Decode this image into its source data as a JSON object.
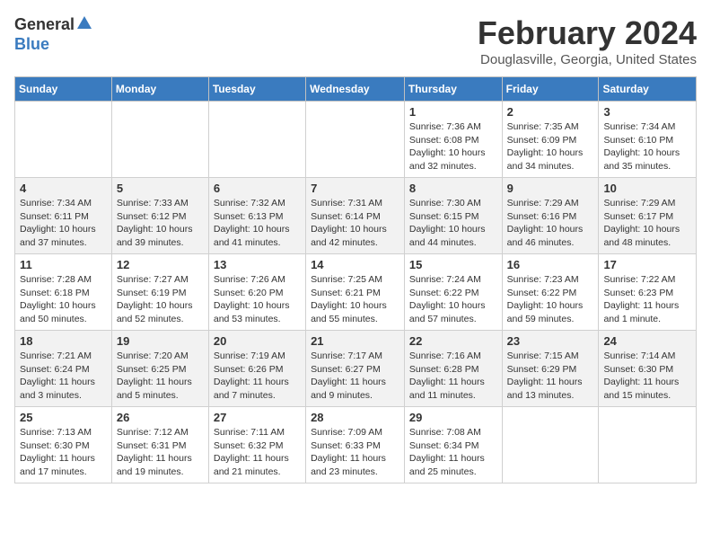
{
  "header": {
    "logo_general": "General",
    "logo_blue": "Blue",
    "month_title": "February 2024",
    "location": "Douglasville, Georgia, United States"
  },
  "days_of_week": [
    "Sunday",
    "Monday",
    "Tuesday",
    "Wednesday",
    "Thursday",
    "Friday",
    "Saturday"
  ],
  "weeks": [
    [
      {
        "day": "",
        "detail": ""
      },
      {
        "day": "",
        "detail": ""
      },
      {
        "day": "",
        "detail": ""
      },
      {
        "day": "",
        "detail": ""
      },
      {
        "day": "1",
        "detail": "Sunrise: 7:36 AM\nSunset: 6:08 PM\nDaylight: 10 hours\nand 32 minutes."
      },
      {
        "day": "2",
        "detail": "Sunrise: 7:35 AM\nSunset: 6:09 PM\nDaylight: 10 hours\nand 34 minutes."
      },
      {
        "day": "3",
        "detail": "Sunrise: 7:34 AM\nSunset: 6:10 PM\nDaylight: 10 hours\nand 35 minutes."
      }
    ],
    [
      {
        "day": "4",
        "detail": "Sunrise: 7:34 AM\nSunset: 6:11 PM\nDaylight: 10 hours\nand 37 minutes."
      },
      {
        "day": "5",
        "detail": "Sunrise: 7:33 AM\nSunset: 6:12 PM\nDaylight: 10 hours\nand 39 minutes."
      },
      {
        "day": "6",
        "detail": "Sunrise: 7:32 AM\nSunset: 6:13 PM\nDaylight: 10 hours\nand 41 minutes."
      },
      {
        "day": "7",
        "detail": "Sunrise: 7:31 AM\nSunset: 6:14 PM\nDaylight: 10 hours\nand 42 minutes."
      },
      {
        "day": "8",
        "detail": "Sunrise: 7:30 AM\nSunset: 6:15 PM\nDaylight: 10 hours\nand 44 minutes."
      },
      {
        "day": "9",
        "detail": "Sunrise: 7:29 AM\nSunset: 6:16 PM\nDaylight: 10 hours\nand 46 minutes."
      },
      {
        "day": "10",
        "detail": "Sunrise: 7:29 AM\nSunset: 6:17 PM\nDaylight: 10 hours\nand 48 minutes."
      }
    ],
    [
      {
        "day": "11",
        "detail": "Sunrise: 7:28 AM\nSunset: 6:18 PM\nDaylight: 10 hours\nand 50 minutes."
      },
      {
        "day": "12",
        "detail": "Sunrise: 7:27 AM\nSunset: 6:19 PM\nDaylight: 10 hours\nand 52 minutes."
      },
      {
        "day": "13",
        "detail": "Sunrise: 7:26 AM\nSunset: 6:20 PM\nDaylight: 10 hours\nand 53 minutes."
      },
      {
        "day": "14",
        "detail": "Sunrise: 7:25 AM\nSunset: 6:21 PM\nDaylight: 10 hours\nand 55 minutes."
      },
      {
        "day": "15",
        "detail": "Sunrise: 7:24 AM\nSunset: 6:22 PM\nDaylight: 10 hours\nand 57 minutes."
      },
      {
        "day": "16",
        "detail": "Sunrise: 7:23 AM\nSunset: 6:22 PM\nDaylight: 10 hours\nand 59 minutes."
      },
      {
        "day": "17",
        "detail": "Sunrise: 7:22 AM\nSunset: 6:23 PM\nDaylight: 11 hours\nand 1 minute."
      }
    ],
    [
      {
        "day": "18",
        "detail": "Sunrise: 7:21 AM\nSunset: 6:24 PM\nDaylight: 11 hours\nand 3 minutes."
      },
      {
        "day": "19",
        "detail": "Sunrise: 7:20 AM\nSunset: 6:25 PM\nDaylight: 11 hours\nand 5 minutes."
      },
      {
        "day": "20",
        "detail": "Sunrise: 7:19 AM\nSunset: 6:26 PM\nDaylight: 11 hours\nand 7 minutes."
      },
      {
        "day": "21",
        "detail": "Sunrise: 7:17 AM\nSunset: 6:27 PM\nDaylight: 11 hours\nand 9 minutes."
      },
      {
        "day": "22",
        "detail": "Sunrise: 7:16 AM\nSunset: 6:28 PM\nDaylight: 11 hours\nand 11 minutes."
      },
      {
        "day": "23",
        "detail": "Sunrise: 7:15 AM\nSunset: 6:29 PM\nDaylight: 11 hours\nand 13 minutes."
      },
      {
        "day": "24",
        "detail": "Sunrise: 7:14 AM\nSunset: 6:30 PM\nDaylight: 11 hours\nand 15 minutes."
      }
    ],
    [
      {
        "day": "25",
        "detail": "Sunrise: 7:13 AM\nSunset: 6:30 PM\nDaylight: 11 hours\nand 17 minutes."
      },
      {
        "day": "26",
        "detail": "Sunrise: 7:12 AM\nSunset: 6:31 PM\nDaylight: 11 hours\nand 19 minutes."
      },
      {
        "day": "27",
        "detail": "Sunrise: 7:11 AM\nSunset: 6:32 PM\nDaylight: 11 hours\nand 21 minutes."
      },
      {
        "day": "28",
        "detail": "Sunrise: 7:09 AM\nSunset: 6:33 PM\nDaylight: 11 hours\nand 23 minutes."
      },
      {
        "day": "29",
        "detail": "Sunrise: 7:08 AM\nSunset: 6:34 PM\nDaylight: 11 hours\nand 25 minutes."
      },
      {
        "day": "",
        "detail": ""
      },
      {
        "day": "",
        "detail": ""
      }
    ]
  ]
}
